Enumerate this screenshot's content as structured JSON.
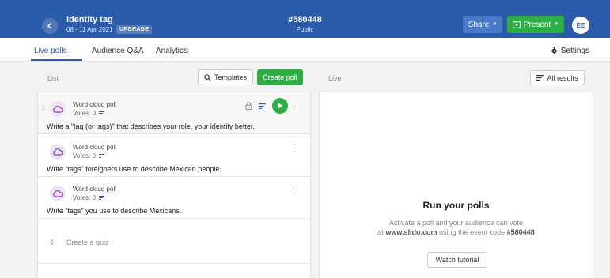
{
  "header": {
    "event_title": "Identity tag",
    "event_date": "08 - 11 Apr 2021",
    "upgrade_label": "UPGRADE",
    "event_code": "#580448",
    "event_visibility": "Public",
    "share_label": "Share",
    "present_label": "Present",
    "avatar_initials": "EE"
  },
  "tabs": [
    {
      "label": "Live polls",
      "active": true
    },
    {
      "label": "Audience Q&A",
      "active": false
    },
    {
      "label": "Analytics",
      "active": false
    }
  ],
  "settings_label": "Settings",
  "list": {
    "label": "List",
    "templates_label": "Templates",
    "create_label": "Create poll",
    "polls": [
      {
        "type": "Word cloud poll",
        "votes": "Votes: 0",
        "question": "Write a \"tag (or tags)\" that describes your role, your identity better."
      },
      {
        "type": "Word cloud poll",
        "votes": "Votes: 0",
        "question": "Write \"tags\" foreigners use to describe Mexican people."
      },
      {
        "type": "Word cloud poll",
        "votes": "Votes: 0",
        "question": "Write \"tags\" you use to describe Mexicans."
      }
    ],
    "create_quiz_label": "Create a quiz"
  },
  "live": {
    "label": "Live",
    "results_label": "All results",
    "title": "Run your polls",
    "desc_line1": "Activate a poll and your audience can vote",
    "desc_at": "at",
    "desc_site": "www.slido.com",
    "desc_middle": "using the event code",
    "desc_code": "#580448",
    "tutorial_label": "Watch tutorial"
  },
  "colors": {
    "header_bg": "#2b5cab",
    "accent_green": "#2fae45",
    "poll_icon": "#8e3fb8"
  }
}
